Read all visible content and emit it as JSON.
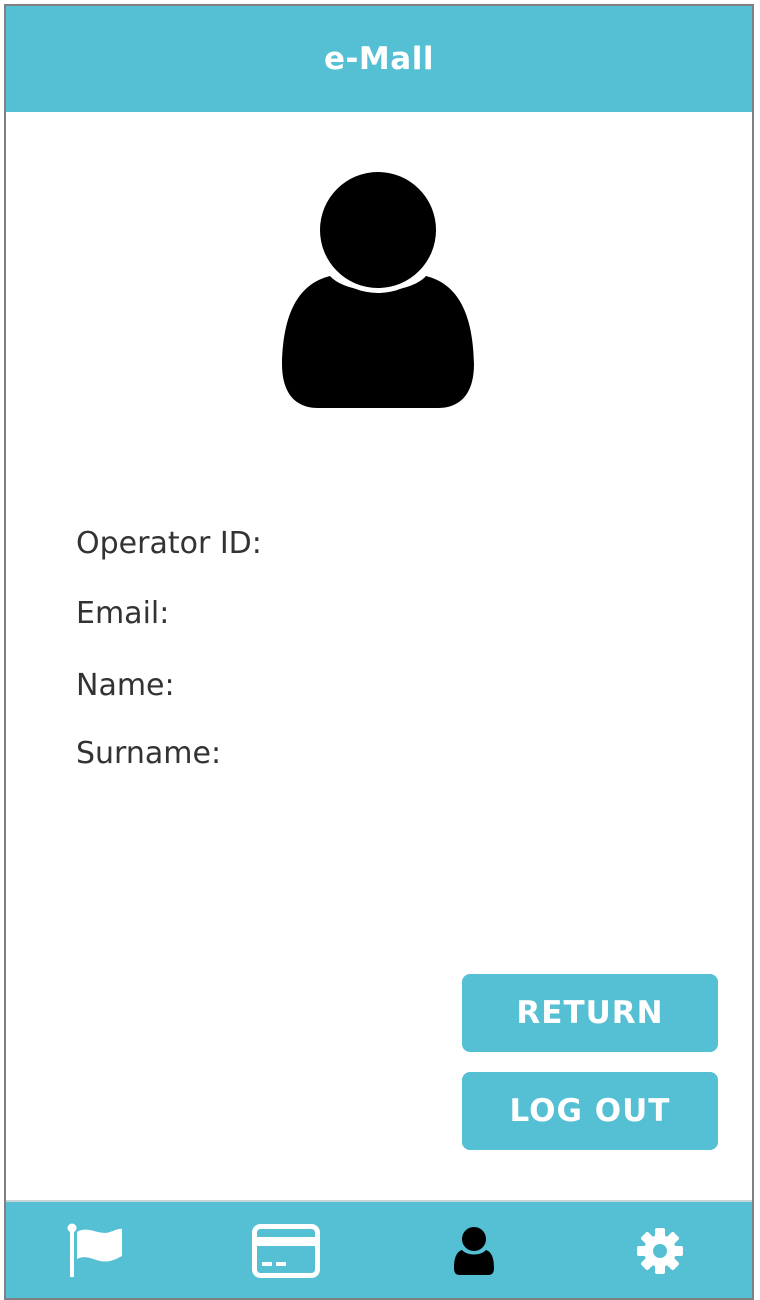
{
  "header": {
    "title": "e-Mall"
  },
  "profile": {
    "avatar_icon": "user-icon",
    "fields": [
      {
        "label": "Operator ID:"
      },
      {
        "label": "Email:"
      },
      {
        "label": "Name:"
      },
      {
        "label": "Surname:"
      }
    ]
  },
  "actions": {
    "return_label": "RETURN",
    "logout_label": "LOG OUT"
  },
  "navbar": {
    "items": [
      {
        "icon": "flag-icon",
        "active": false
      },
      {
        "icon": "card-icon",
        "active": false
      },
      {
        "icon": "user-icon",
        "active": true
      },
      {
        "icon": "gear-icon",
        "active": false
      }
    ]
  },
  "colors": {
    "accent": "#55bfd4",
    "text": "#333333",
    "active_icon": "#000000",
    "inactive_icon": "#ffffff"
  }
}
